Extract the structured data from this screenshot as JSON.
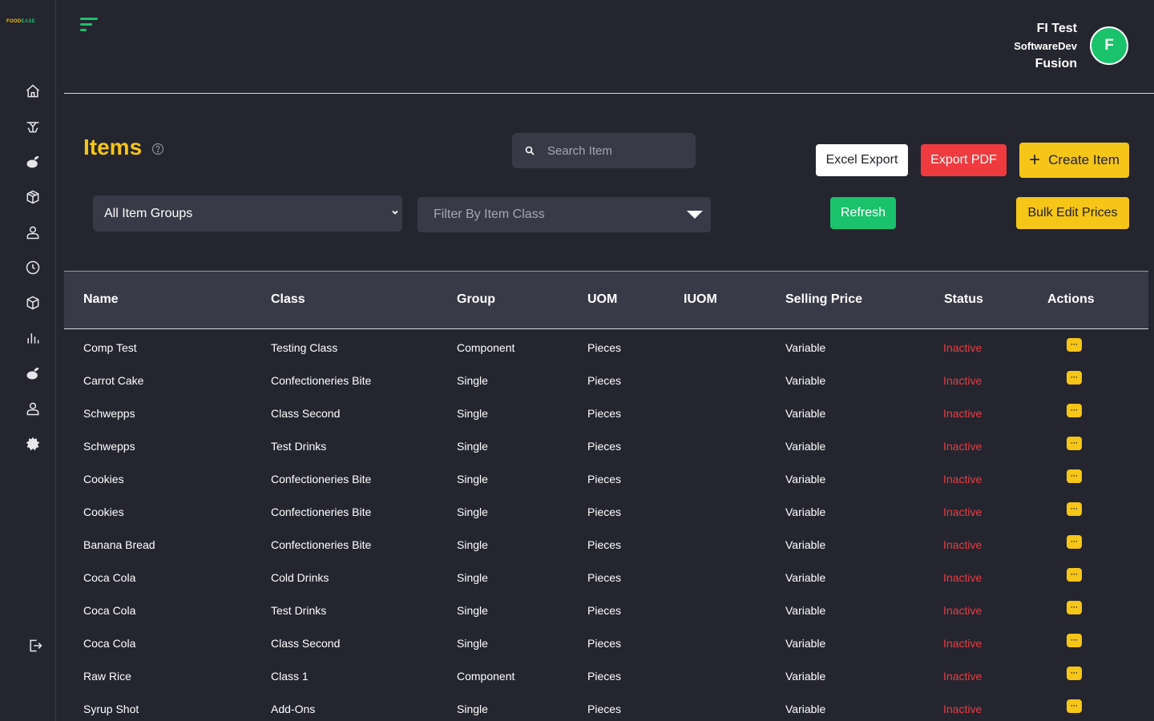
{
  "logo": {
    "part1": "FOOD",
    "part2": "EASE"
  },
  "sidebar": {
    "items": [
      {
        "icon": "home-icon"
      },
      {
        "icon": "dining-table-icon"
      },
      {
        "icon": "fruit-icon"
      },
      {
        "icon": "box-icon"
      },
      {
        "icon": "user-icon"
      },
      {
        "icon": "clock-icon"
      },
      {
        "icon": "package-icon"
      },
      {
        "icon": "bar-chart-icon"
      },
      {
        "icon": "fruit-basket-icon"
      },
      {
        "icon": "staff-icon"
      },
      {
        "icon": "settings-icon"
      }
    ],
    "logout_icon": "logout-icon"
  },
  "user": {
    "name": "FI Test",
    "company": "SoftwareDev",
    "subtitle": "Fusion",
    "avatar_initial": "F"
  },
  "page": {
    "title": "Items"
  },
  "search": {
    "placeholder": "Search Item"
  },
  "buttons": {
    "excel": "Excel Export",
    "pdf": "Export PDF",
    "create": "Create Item",
    "refresh": "Refresh",
    "bulk": "Bulk Edit Prices"
  },
  "filters": {
    "group_selected": "All Item Groups",
    "class_placeholder": "Filter By Item Class"
  },
  "table": {
    "headers": {
      "name": "Name",
      "class": "Class",
      "group": "Group",
      "uom": "UOM",
      "iuom": "IUOM",
      "price": "Selling Price",
      "status": "Status",
      "actions": "Actions"
    },
    "action_label": "···",
    "rows": [
      {
        "name": "Comp Test",
        "class": "Testing Class",
        "group": "Component",
        "uom": "Pieces",
        "iuom": "",
        "price": "Variable",
        "status": "Inactive"
      },
      {
        "name": "Carrot Cake",
        "class": "Confectioneries Bite",
        "group": "Single",
        "uom": "Pieces",
        "iuom": "",
        "price": "Variable",
        "status": "Inactive"
      },
      {
        "name": "Schwepps",
        "class": "Class Second",
        "group": "Single",
        "uom": "Pieces",
        "iuom": "",
        "price": "Variable",
        "status": "Inactive"
      },
      {
        "name": "Schwepps",
        "class": "Test Drinks",
        "group": "Single",
        "uom": "Pieces",
        "iuom": "",
        "price": "Variable",
        "status": "Inactive"
      },
      {
        "name": "Cookies",
        "class": "Confectioneries Bite",
        "group": "Single",
        "uom": "Pieces",
        "iuom": "",
        "price": "Variable",
        "status": "Inactive"
      },
      {
        "name": "Cookies",
        "class": "Confectioneries Bite",
        "group": "Single",
        "uom": "Pieces",
        "iuom": "",
        "price": "Variable",
        "status": "Inactive"
      },
      {
        "name": "Banana Bread",
        "class": "Confectioneries Bite",
        "group": "Single",
        "uom": "Pieces",
        "iuom": "",
        "price": "Variable",
        "status": "Inactive"
      },
      {
        "name": "Coca Cola",
        "class": "Cold Drinks",
        "group": "Single",
        "uom": "Pieces",
        "iuom": "",
        "price": "Variable",
        "status": "Inactive"
      },
      {
        "name": "Coca Cola",
        "class": "Test Drinks",
        "group": "Single",
        "uom": "Pieces",
        "iuom": "",
        "price": "Variable",
        "status": "Inactive"
      },
      {
        "name": "Coca Cola",
        "class": "Class Second",
        "group": "Single",
        "uom": "Pieces",
        "iuom": "",
        "price": "Variable",
        "status": "Inactive"
      },
      {
        "name": "Raw Rice",
        "class": "Class 1",
        "group": "Component",
        "uom": "Pieces",
        "iuom": "",
        "price": "Variable",
        "status": "Inactive"
      },
      {
        "name": "Syrup Shot",
        "class": "Add-Ons",
        "group": "Single",
        "uom": "Pieces",
        "iuom": "",
        "price": "Variable",
        "status": "Inactive"
      }
    ]
  },
  "colors": {
    "background": "#24252f",
    "accent_yellow": "#f5c518",
    "accent_green": "#19c26b",
    "danger_red": "#ef3b3f",
    "input_bg": "#393a47"
  }
}
